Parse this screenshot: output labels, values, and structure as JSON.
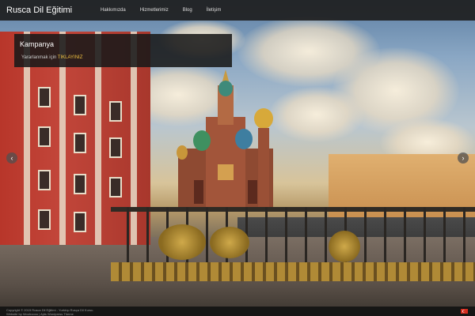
{
  "site": {
    "title": "Rusca Dil Eğitimi"
  },
  "nav": [
    {
      "label": "Hakkımızda"
    },
    {
      "label": "Hizmetlerimiz"
    },
    {
      "label": "Blog"
    },
    {
      "label": "İletişim"
    }
  ],
  "campaign": {
    "title": "Kampanya",
    "text": "Yararlanmak için ",
    "link": "TIKLAYINIZ"
  },
  "slider": {
    "prev_icon": "chevron-left-icon",
    "next_icon": "chevron-right-icon"
  },
  "footer": {
    "line1": "Copyright © 2015 Rusca Dil Eğitimi - Yurtdışı Rusça Dil Kursu.",
    "line2": "Website by Woohoooo | Ajds Wordpress Theme"
  },
  "colors": {
    "accent_link": "#f0c040",
    "topbar": "#1e1e1e"
  }
}
